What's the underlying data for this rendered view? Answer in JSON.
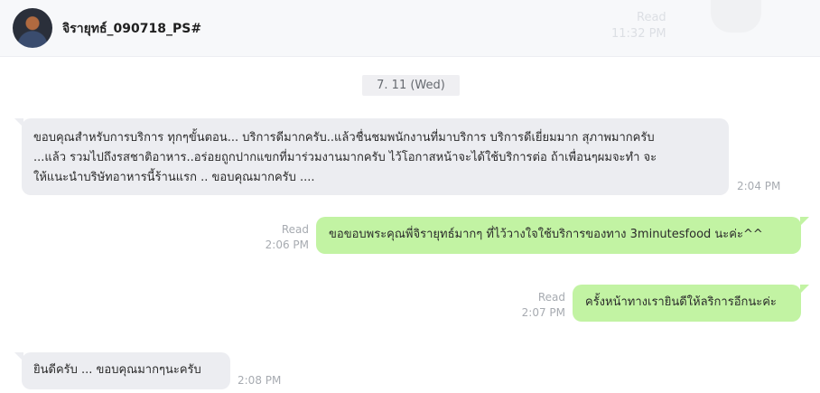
{
  "header": {
    "contact_name": "จิรายุทธ์_090718_PS#",
    "ghost_read": "Read",
    "ghost_time": "11:32 PM"
  },
  "date_separator": "7. 11 (Wed)",
  "messages": [
    {
      "direction": "incoming",
      "lines": [
        "ขอบคุณสำหรับการบริการ ทุกๆขั้นตอน... บริการดีมากครับ..แล้วชื่นชมพนักงานที่มาบริการ บริการดีเยี่ยมมาก สุภาพมากครับ",
        "...แล้ว รวมไปถึงรสชาติอาหาร..อร่อยถูกปากแขกที่มาร่วมงานมากครับ ไว้โอกาสหน้าจะได้ใช้บริการต่อ ถ้าเพื่อนๆผมจะทำ จะ",
        "ให้แนะนำบริษัทอาหารนี้ร้านแรก .. ขอบคุณมากครับ ...."
      ],
      "time": "2:04 PM"
    },
    {
      "direction": "outgoing",
      "text": "ขอขอบพระคุณพี่จิรายุทธ์มากๆ ที่ไว้วางใจใช้บริการของทาง 3minutesfood นะค่ะ^^",
      "status": "Read",
      "time": "2:06 PM"
    },
    {
      "direction": "outgoing",
      "text": "ครั้งหน้าทางเรายินดีให้ลริการอีกนะค่ะ",
      "status": "Read",
      "time": "2:07 PM"
    },
    {
      "direction": "incoming",
      "text": "ยินดีครับ  ... ขอบคุณมากๆนะครับ",
      "time": "2:08 PM"
    }
  ],
  "colors": {
    "incoming_bubble": "#ecedf1",
    "outgoing_bubble": "#c2f3a3",
    "header_bg": "#f7f8fa",
    "meta_text": "#a7abb1"
  }
}
